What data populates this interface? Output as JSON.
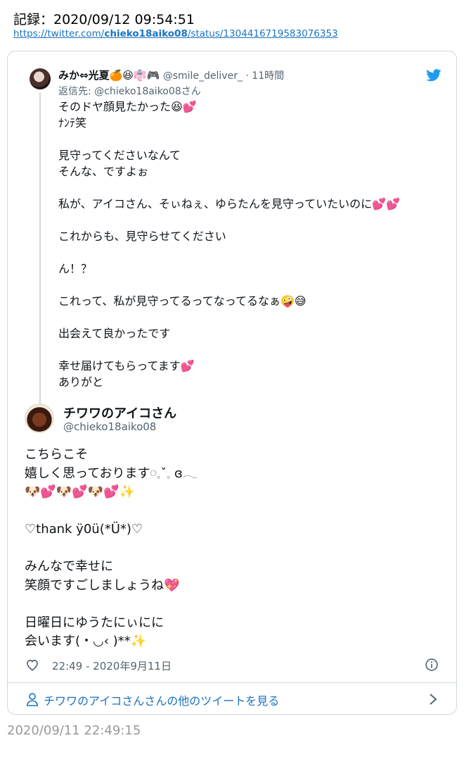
{
  "record": {
    "title": "記録：2020/09/12 09:54:51",
    "url_prefix": "https://twitter.com/",
    "url_user": "chieko18aiko08",
    "url_suffix": "/status/1304416719583076353"
  },
  "quote": {
    "name": "みか⇔光夏🍊😆👘🎮",
    "handle_time": " @smile_deliver_ · 11時間",
    "reply_to": "返信先: @chieko18aiko08さん",
    "body": "そのドヤ顔見たかった😆💕\nﾅﾝﾃ笑\n\n見守ってくださいなんて\nそんな、ですよぉ\n\n私が、アイコさん、そぃねぇ、ゆらたんを見守っていたいのに💕💕\n\nこれからも、見守らせてください\n\nん！？\n\nこれって、私が見守ってるってなってるなぁ🤪😅\n\n出会えて良かったです\n\n幸せ届けてもらってます💕\nありがと"
  },
  "tweet": {
    "name": "チワワのアイコさん",
    "handle": "@chieko18aiko08",
    "body": "こちらこそ\n嬉しく思っております𓏸𓈒ˇ𓈒 ɞ𓂃\n🐶💕🐶💕🐶💕✨\n\n♡thank ÿ0ü(*Ü*)♡\n\nみんなで幸せに\n笑顔ですごしましょうね💖\n\n日曜日にゆうたにぃにに\n会います(・◡‹ )**✨",
    "time": "22:49 - 2020年9月11日",
    "more_label": "チワワのアイコさんさんの他のツイートを見る"
  },
  "saved_time": "2020/09/11 22:49:15",
  "colors": {
    "link": "#1b73c0",
    "twitter_blue": "#1d9bf0",
    "secondary_text": "#536471",
    "border": "#cfd9de"
  },
  "icons": {
    "brand": "twitter-bird-icon",
    "like": "heart-outline-icon",
    "info": "info-icon",
    "profile": "person-icon",
    "more": "chevron-right-icon"
  }
}
